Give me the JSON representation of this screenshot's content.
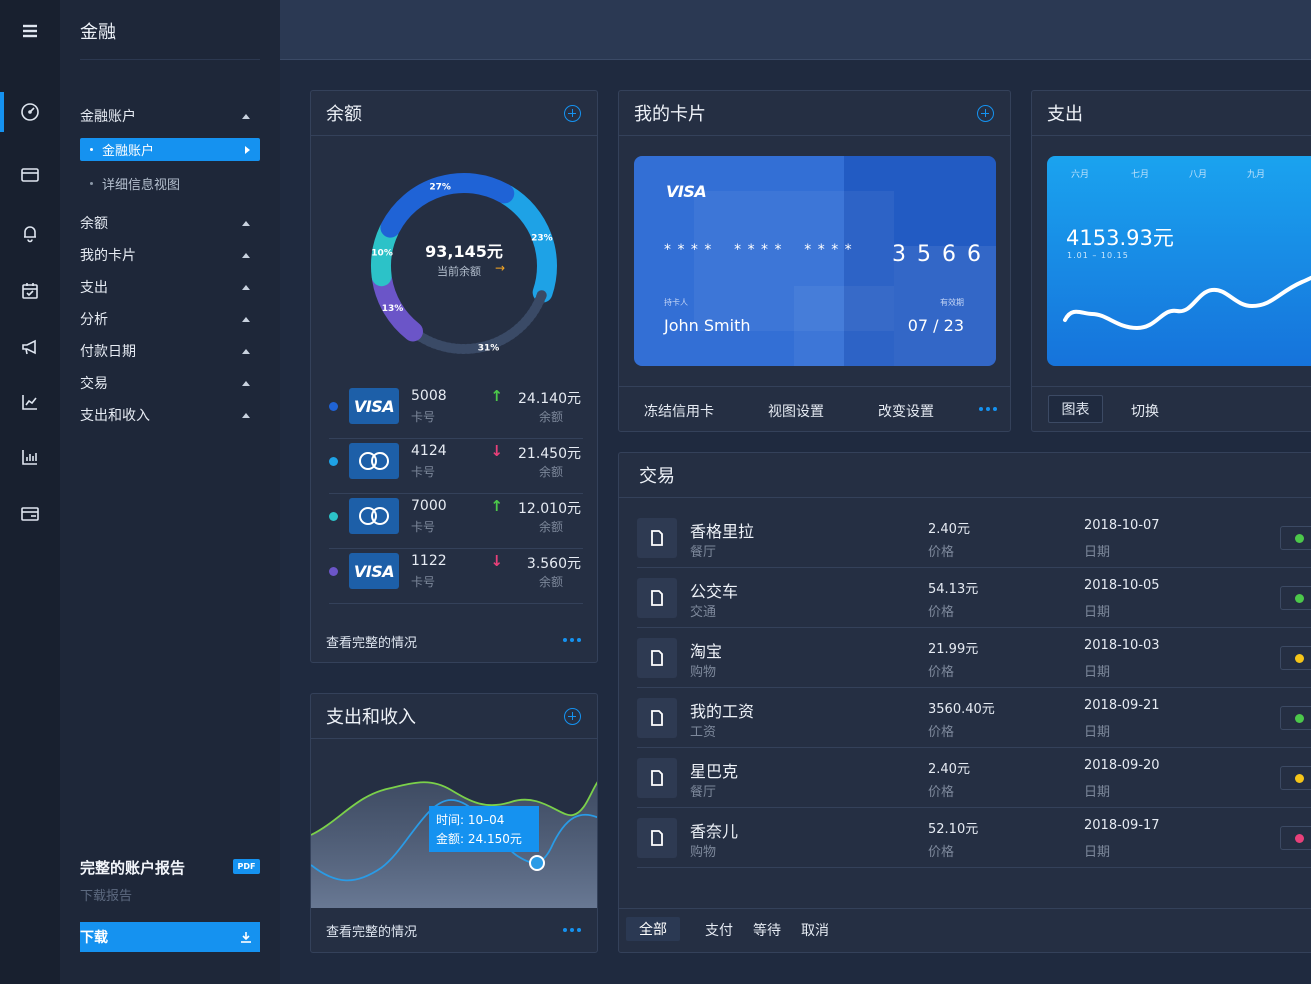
{
  "app": {
    "title": "金融"
  },
  "rail": {
    "icons": [
      "menu-icon",
      "dashboard-icon",
      "wallet-icon",
      "bell-icon",
      "calendar-icon",
      "megaphone-icon",
      "trend-icon",
      "bar-chart-icon",
      "card-icon"
    ]
  },
  "sidebar": {
    "group_accounts": "金融账户",
    "sub_active": "金融账户",
    "sub_detail": "详细信息视图",
    "items": [
      {
        "label": "余额"
      },
      {
        "label": "我的卡片"
      },
      {
        "label": "支出"
      },
      {
        "label": "分析"
      },
      {
        "label": "付款日期"
      },
      {
        "label": "交易"
      },
      {
        "label": "支出和收入"
      }
    ],
    "report_title": "完整的账户报告",
    "pdf_badge": "PDF",
    "report_sub": "下载报告",
    "download": "下载"
  },
  "balance": {
    "title": "余额",
    "total": "93,145元",
    "total_label": "当前余额",
    "segments": [
      {
        "label": "23%",
        "value": 23,
        "color": "#1ea2e6"
      },
      {
        "label": "31%",
        "value": 31,
        "color": "#3a4a66"
      },
      {
        "label": "13%",
        "value": 13,
        "color": "#6b55c8"
      },
      {
        "label": "10%",
        "value": 10,
        "color": "#2cc2c8"
      },
      {
        "label": "27%",
        "value": 27,
        "color": "#1f63d6"
      }
    ],
    "accounts": [
      {
        "brand": "VISA",
        "number": "5008",
        "number_label": "卡号",
        "amount": "24.140元",
        "amount_label": "余额",
        "trend": "up",
        "dot": "#1f63d6"
      },
      {
        "brand": "MC",
        "number": "4124",
        "number_label": "卡号",
        "amount": "21.450元",
        "amount_label": "余额",
        "trend": "down",
        "dot": "#1ea2e6"
      },
      {
        "brand": "MC",
        "number": "7000",
        "number_label": "卡号",
        "amount": "12.010元",
        "amount_label": "余额",
        "trend": "up",
        "dot": "#2cc2c8"
      },
      {
        "brand": "VISA",
        "number": "1122",
        "number_label": "卡号",
        "amount": "3.560元",
        "amount_label": "余额",
        "trend": "down",
        "dot": "#6b55c8"
      }
    ],
    "footer": "查看完整的情况"
  },
  "mycard": {
    "title": "我的卡片",
    "brand": "VISA",
    "masked": "* * * *    * * * *    * * * *",
    "last4": "3 5 6 6",
    "holder_label": "持卡人",
    "holder": "John Smith",
    "expiry_label": "有效期",
    "expiry": "07 / 23",
    "actions": [
      "冻结信用卡",
      "视图设置",
      "改变设置"
    ]
  },
  "expense": {
    "title": "支出",
    "months": [
      "六月",
      "七月",
      "八月",
      "九月"
    ],
    "amount": "4153.93元",
    "range": "1.01 – 10.15",
    "tabs": [
      "图表",
      "切换"
    ]
  },
  "income": {
    "title": "支出和收入",
    "tooltip_time_label": "时间:",
    "tooltip_time": "10–04",
    "tooltip_amount_label": "金额:",
    "tooltip_amount": "24.150元",
    "footer": "查看完整的情况"
  },
  "transactions": {
    "title": "交易",
    "price_label": "价格",
    "date_label": "日期",
    "rows": [
      {
        "name": "香格里拉",
        "category": "餐厅",
        "price": "2.40元",
        "date": "2018-10-07",
        "status_color": "#4cc84a"
      },
      {
        "name": "公交车",
        "category": "交通",
        "price": "54.13元",
        "date": "2018-10-05",
        "status_color": "#4cc84a"
      },
      {
        "name": "淘宝",
        "category": "购物",
        "price": "21.99元",
        "date": "2018-10-03",
        "status_color": "#f5c518"
      },
      {
        "name": "我的工资",
        "category": "工资",
        "price": "3560.40元",
        "date": "2018-09-21",
        "status_color": "#4cc84a"
      },
      {
        "name": "星巴克",
        "category": "餐厅",
        "price": "2.40元",
        "date": "2018-09-20",
        "status_color": "#f5c518"
      },
      {
        "name": "香奈儿",
        "category": "购物",
        "price": "52.10元",
        "date": "2018-09-17",
        "status_color": "#e8407a"
      }
    ],
    "filters": [
      "全部",
      "支付",
      "等待",
      "取消"
    ]
  },
  "colors": {
    "accent": "#1592f0",
    "up": "#4cc84a",
    "down": "#e8407a"
  }
}
